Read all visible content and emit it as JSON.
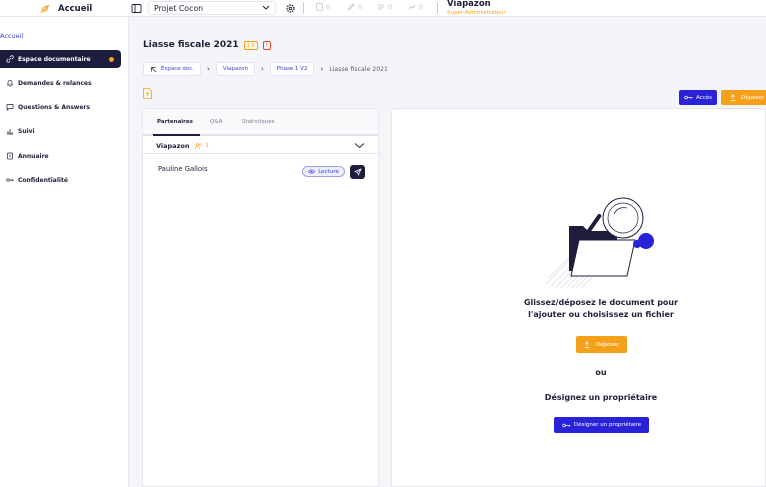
{
  "topbar": {
    "home_label": "Accueil",
    "project_label": "Projet Cocon",
    "stats": [
      "0",
      "0",
      "0",
      "0"
    ],
    "user_name": "Viapazon",
    "user_role": "Super-Administrateur"
  },
  "sidebar": {
    "home": "Accueil",
    "items": [
      {
        "label": "Espace documentaire",
        "icon": "link-icon"
      },
      {
        "label": "Demandes & relances",
        "icon": "bell-icon"
      },
      {
        "label": "Questions & Answers",
        "icon": "chat-icon"
      },
      {
        "label": "Suivi",
        "icon": "chart-icon"
      },
      {
        "label": "Annuaire",
        "icon": "book-icon"
      },
      {
        "label": "Confidentialité",
        "icon": "key-icon"
      }
    ]
  },
  "document": {
    "title": "Liasse fiscale 2021",
    "version": "1.5",
    "alert": "!"
  },
  "breadcrumb": {
    "items": [
      "Espace doc.",
      "Viapazon",
      "Phase 1 V2"
    ],
    "current": "Liasse fiscale 2021"
  },
  "actions": {
    "acces": "Accès",
    "deposer": "Déposer"
  },
  "tabs": [
    "Partenaires",
    "Q&A",
    "Statistiques"
  ],
  "group": {
    "name": "Viapazon",
    "count": "1"
  },
  "partner": {
    "name": "Pauline Gallois",
    "permission": "Lecture"
  },
  "dropzone": {
    "line1": "Glissez/déposez le document pour",
    "line2": "l'ajouter ou choisissez un fichier",
    "button": "Déposer",
    "or": "ou",
    "owner_title": "Désignez un propriétaire",
    "owner_button": "Désigner un propriétaire"
  },
  "colors": {
    "navy": "#1d1e3d",
    "blue": "#2a22d8",
    "orange": "#f5a01a"
  }
}
